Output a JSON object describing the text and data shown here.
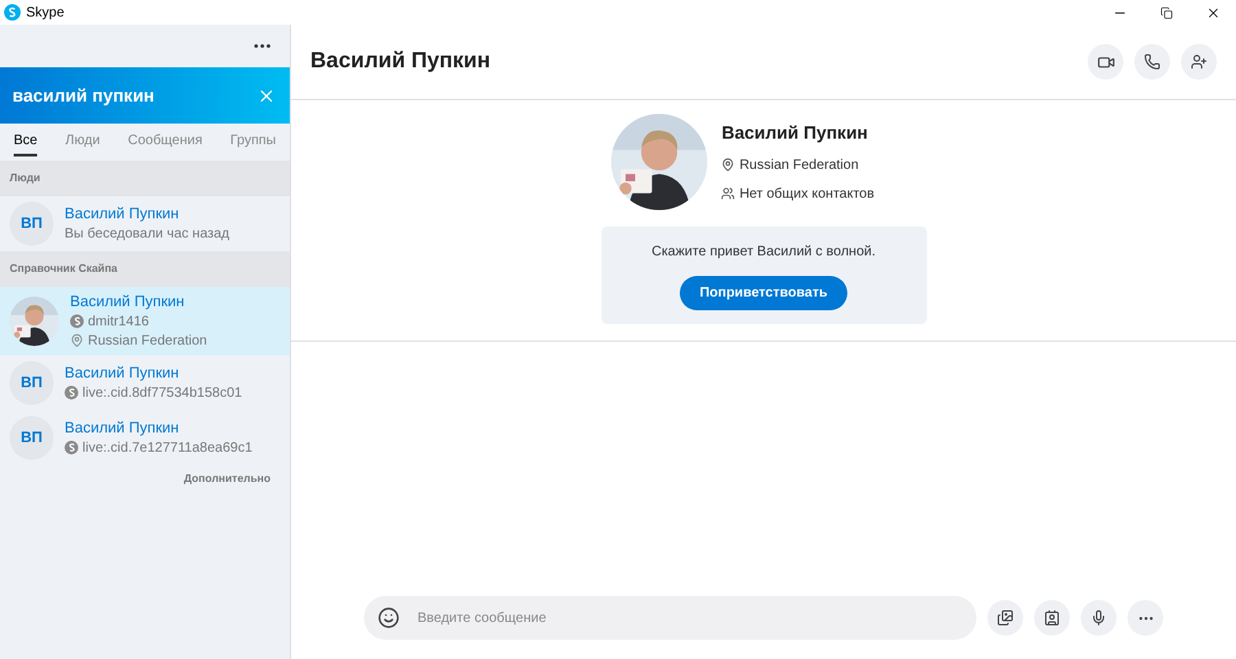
{
  "window": {
    "title": "Skype"
  },
  "sidebar": {
    "search": {
      "value": "василий пупкин"
    },
    "tabs": [
      {
        "label": "Все",
        "selected": true
      },
      {
        "label": "Люди",
        "selected": false
      },
      {
        "label": "Сообщения",
        "selected": false
      },
      {
        "label": "Группы",
        "selected": false
      }
    ],
    "sections": [
      {
        "title": "Люди",
        "items": [
          {
            "avatar": {
              "kind": "initials",
              "initials": "ВП"
            },
            "name": "Василий Пупкин",
            "selected": false,
            "lines": [
              {
                "kind": "text",
                "text": "Вы беседовали час назад"
              }
            ]
          }
        ]
      },
      {
        "title": "Справочник Скайпа",
        "items": [
          {
            "avatar": {
              "kind": "picture"
            },
            "name": "Василий Пупкин",
            "selected": true,
            "lines": [
              {
                "kind": "skype",
                "text": "dmitr1416"
              },
              {
                "kind": "location",
                "text": "Russian Federation"
              }
            ]
          },
          {
            "avatar": {
              "kind": "initials",
              "initials": "ВП"
            },
            "name": "Василий Пупкин",
            "selected": false,
            "lines": [
              {
                "kind": "skype",
                "text": "live:.cid.8df77534b158c01"
              }
            ]
          },
          {
            "avatar": {
              "kind": "initials",
              "initials": "ВП"
            },
            "name": "Василий Пупкин",
            "selected": false,
            "lines": [
              {
                "kind": "skype",
                "text": "live:.cid.7e127711a8ea69c1"
              }
            ]
          }
        ]
      }
    ],
    "more_link": "Дополнительно"
  },
  "conversation": {
    "title": "Василий Пупкин",
    "profile": {
      "name": "Василий Пупкин",
      "location": "Russian Federation",
      "contacts": "Нет общих контактов"
    },
    "greeting": {
      "text": "Скажите привет Василий с волной.",
      "button": "Поприветствовать"
    },
    "composer": {
      "placeholder": "Введите сообщение"
    }
  }
}
